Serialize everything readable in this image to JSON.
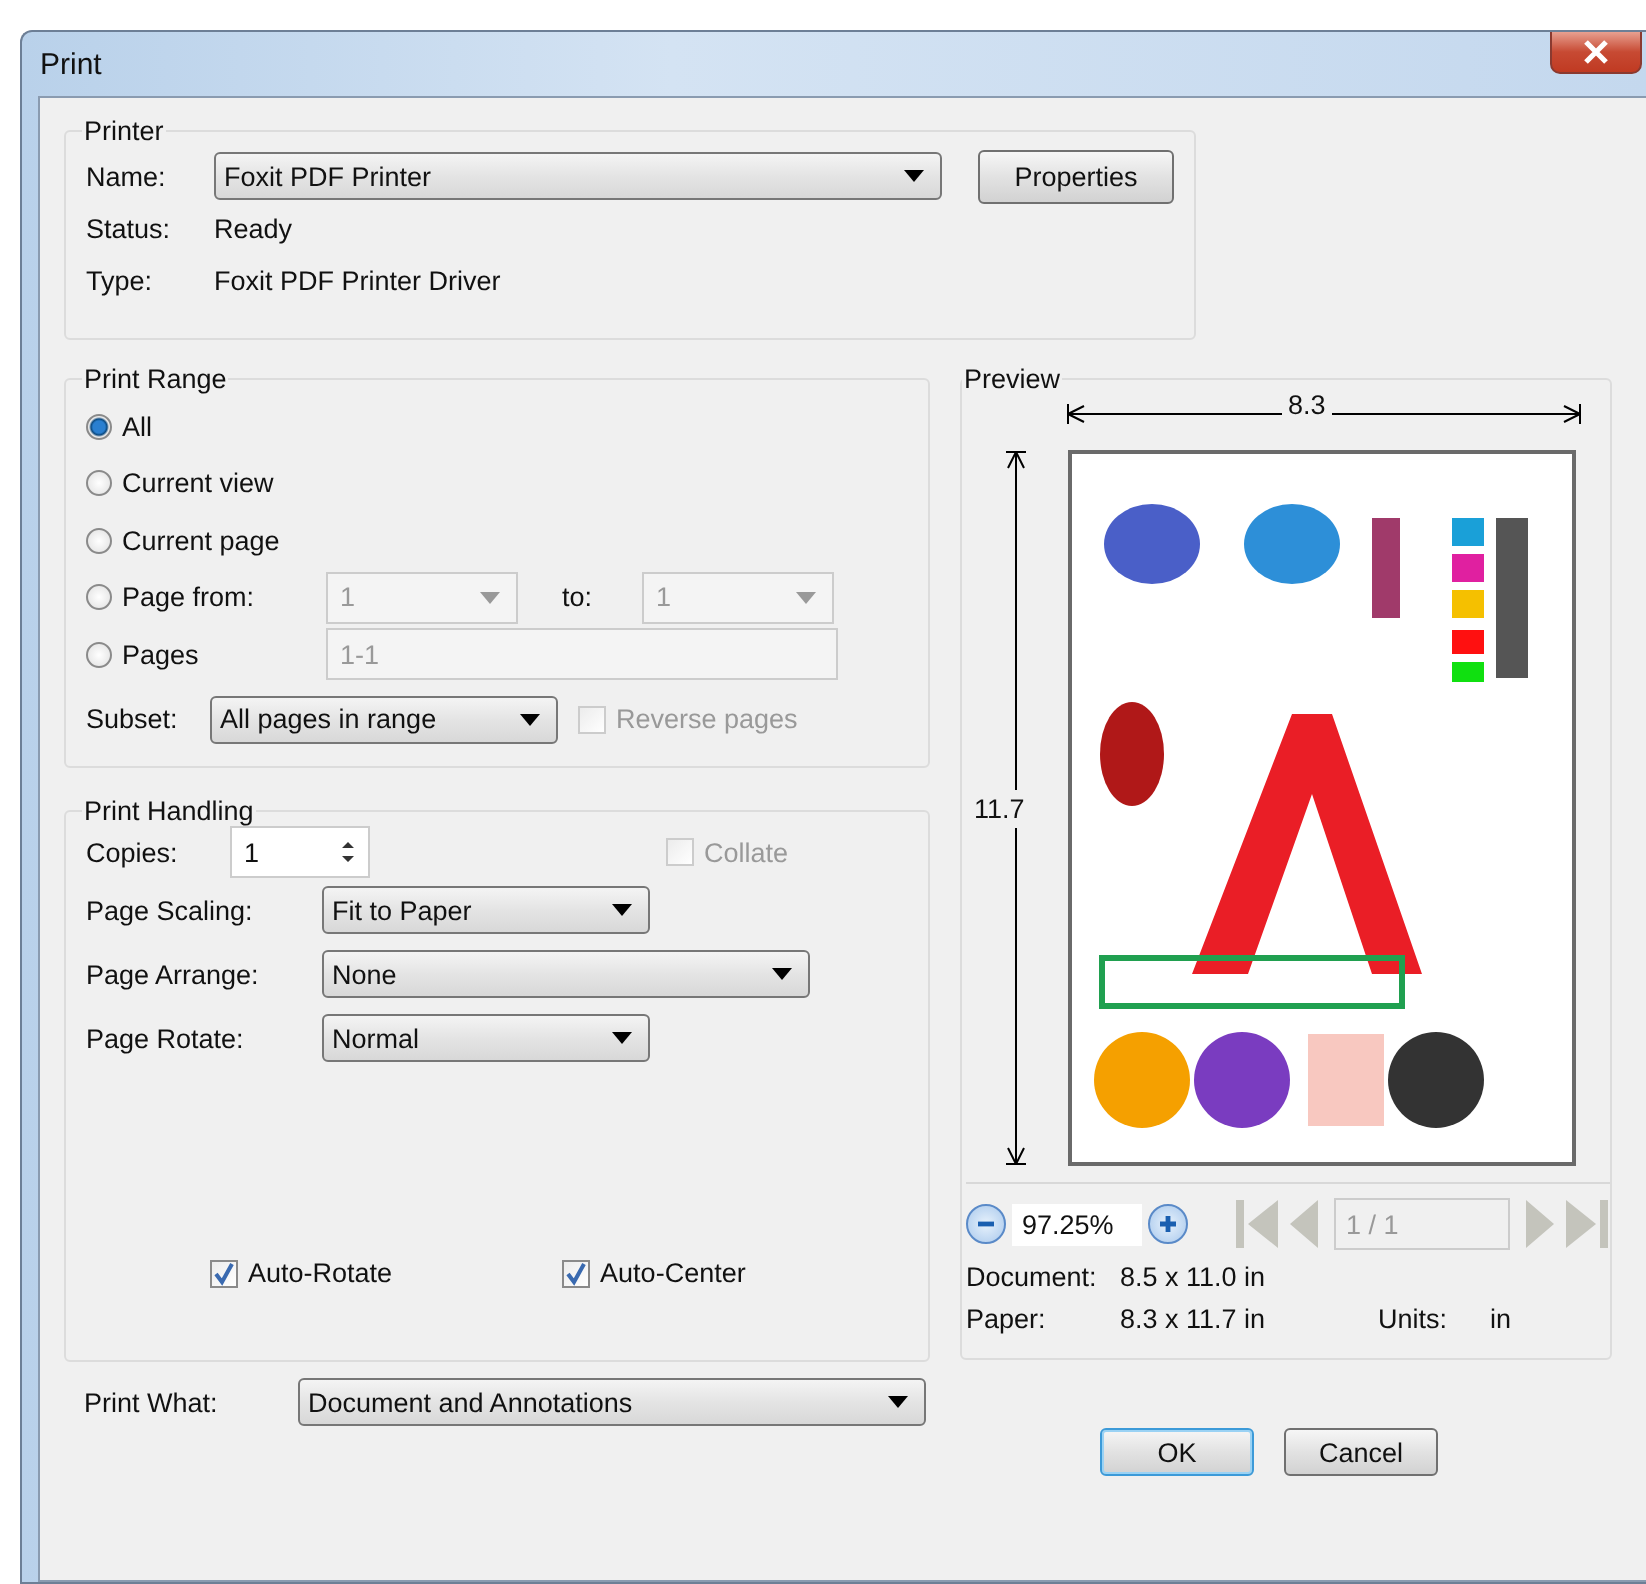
{
  "window": {
    "title": "Print"
  },
  "printer": {
    "title": "Printer",
    "name_label": "Name:",
    "name_value": "Foxit PDF Printer",
    "properties_button": "Properties",
    "status_label": "Status:",
    "status_value": "Ready",
    "type_label": "Type:",
    "type_value": "Foxit PDF Printer Driver"
  },
  "print_range": {
    "title": "Print Range",
    "options": [
      {
        "label": "All",
        "selected": true
      },
      {
        "label": "Current view",
        "selected": false
      },
      {
        "label": "Current page",
        "selected": false
      },
      {
        "label": "Page from:",
        "selected": false,
        "from": "1",
        "to_label": "to:",
        "to": "1"
      },
      {
        "label": "Pages",
        "selected": false,
        "pages": "1-1"
      }
    ],
    "fields_disabled": true,
    "subset_label": "Subset:",
    "subset_value": "All pages in range",
    "reverse_pages": {
      "label": "Reverse pages",
      "checked": false,
      "disabled": true
    }
  },
  "print_handling": {
    "title": "Print Handling",
    "copies_label": "Copies:",
    "copies_value": "1",
    "collate": {
      "label": "Collate",
      "checked": false,
      "disabled": true
    },
    "selects": [
      {
        "label": "Page Scaling:",
        "value": "Fit to Paper",
        "kind": "narrow"
      },
      {
        "label": "Page Arrange:",
        "value": "None",
        "kind": "wide"
      },
      {
        "label": "Page Rotate:",
        "value": "Normal",
        "kind": "narrow"
      }
    ],
    "checkboxes": [
      {
        "label": "Auto-Rotate",
        "checked": true
      },
      {
        "label": "Auto-Center",
        "checked": true
      }
    ]
  },
  "print_what": {
    "label": "Print What:",
    "value": "Document and Annotations"
  },
  "preview": {
    "title": "Preview",
    "width_label": "8.3",
    "height_label": "11.7",
    "zoom": "97.25%",
    "page": "1 / 1",
    "nav_disabled": true,
    "document_label": "Document:",
    "document_value": "8.5 x 11.0 in",
    "paper_label": "Paper:",
    "paper_value": "8.3 x 11.7 in",
    "units_label": "Units:",
    "units_value": "in"
  },
  "buttons": [
    {
      "label": "OK",
      "default": true
    },
    {
      "label": "Cancel",
      "default": false
    }
  ]
}
